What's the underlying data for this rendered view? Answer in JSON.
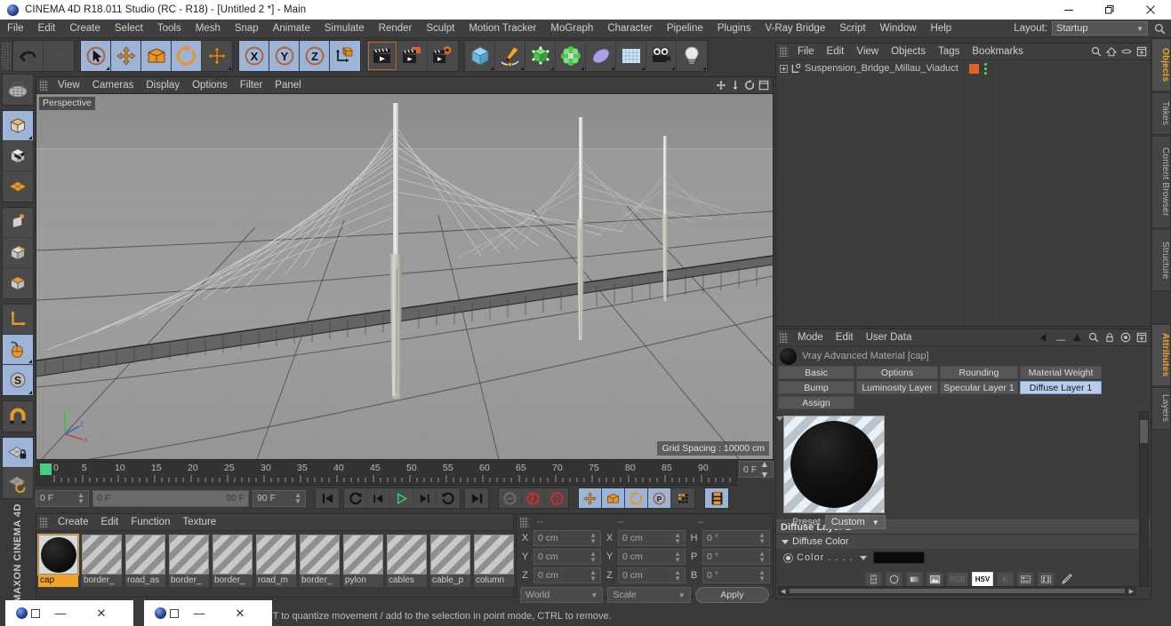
{
  "window": {
    "title": "CINEMA 4D R18.011 Studio (RC - R18) - [Untitled 2 *] - Main",
    "app_icon": "cinema4d-icon",
    "minimize": "minimize-icon",
    "maximize": "restore-icon",
    "close": "close-icon"
  },
  "menubar": {
    "items": [
      "File",
      "Edit",
      "Create",
      "Select",
      "Tools",
      "Mesh",
      "Snap",
      "Animate",
      "Simulate",
      "Render",
      "Sculpt",
      "Motion Tracker",
      "MoGraph",
      "Character",
      "Pipeline",
      "Plugins",
      "V-Ray Bridge",
      "Script",
      "Window",
      "Help"
    ],
    "layout_label": "Layout:",
    "layout_value": "Startup",
    "search_icon": "search-icon"
  },
  "toolbar": {
    "groups": [
      {
        "name": "history",
        "buttons": [
          {
            "name": "undo-button",
            "icon": "undo-arrow-icon",
            "state": "enabled"
          },
          {
            "name": "redo-button",
            "icon": "redo-arrow-icon",
            "state": "disabled"
          }
        ]
      },
      {
        "name": "tools",
        "buttons": [
          {
            "name": "live-selection-tool",
            "icon": "cursor-arrow-icon",
            "state": "active"
          },
          {
            "name": "move-tool",
            "icon": "move-cross-icon",
            "state": "active"
          },
          {
            "name": "scale-tool",
            "icon": "scale-box-icon",
            "state": "active"
          },
          {
            "name": "rotate-tool",
            "icon": "rotate-circle-icon",
            "state": "active"
          },
          {
            "name": "dynamic-place-tool",
            "icon": "move-cross-icon",
            "state": "enabled"
          }
        ]
      },
      {
        "name": "axis-locks",
        "buttons": [
          {
            "name": "lock-x-axis",
            "icon": "x-axis-icon",
            "state": "active"
          },
          {
            "name": "lock-y-axis",
            "icon": "y-axis-icon",
            "state": "active"
          },
          {
            "name": "lock-z-axis",
            "icon": "z-axis-icon",
            "state": "active"
          },
          {
            "name": "world-object-coordinates",
            "icon": "world-axis-cube-icon",
            "state": "enabled"
          }
        ]
      },
      {
        "name": "render",
        "buttons": [
          {
            "name": "render-view-button",
            "icon": "clapperboard-icon",
            "state": "enabled"
          },
          {
            "name": "render-to-picture-viewer-button",
            "icon": "clapperboard-picture-icon",
            "state": "enabled"
          },
          {
            "name": "edit-render-settings-button",
            "icon": "clapperboard-gear-icon",
            "state": "enabled"
          }
        ]
      },
      {
        "name": "create",
        "buttons": [
          {
            "name": "add-cube-button",
            "icon": "cube-icon",
            "state": "enabled"
          },
          {
            "name": "add-spline-button",
            "icon": "pen-spline-icon",
            "state": "enabled"
          },
          {
            "name": "add-generator-button",
            "icon": "green-nurbs-icon",
            "state": "enabled"
          },
          {
            "name": "add-deformer-button",
            "icon": "deformer-icon",
            "state": "enabled"
          },
          {
            "name": "add-scene-object-button",
            "icon": "environment-icon",
            "state": "enabled"
          },
          {
            "name": "add-physical-sky-button",
            "icon": "sky-grid-icon",
            "state": "enabled"
          },
          {
            "name": "add-camera-button",
            "icon": "camera-icon",
            "state": "enabled"
          },
          {
            "name": "add-light-button",
            "icon": "lightbulb-icon",
            "state": "enabled"
          }
        ]
      }
    ]
  },
  "leftbar": {
    "groups": [
      [
        {
          "name": "undo-view-button",
          "icon": "globe-wire-icon",
          "state": "enabled"
        }
      ],
      [
        {
          "name": "model-mode-button",
          "icon": "model-cube-icon",
          "state": "active"
        },
        {
          "name": "texture-mode-button",
          "icon": "texture-cube-icon",
          "state": "enabled"
        },
        {
          "name": "workplane-mode-button",
          "icon": "workplane-grid-icon",
          "state": "enabled"
        }
      ],
      [
        {
          "name": "points-mode-button",
          "icon": "points-cube-icon",
          "state": "enabled"
        },
        {
          "name": "edges-mode-button",
          "icon": "edges-cube-icon",
          "state": "enabled"
        },
        {
          "name": "polygons-mode-button",
          "icon": "polygons-cube-icon",
          "state": "enabled"
        }
      ],
      [
        {
          "name": "object-axis-button",
          "icon": "axis-L-icon",
          "state": "enabled"
        },
        {
          "name": "enable-axis-modification-button",
          "icon": "mouse-icon",
          "state": "active"
        },
        {
          "name": "soft-selection-button",
          "icon": "S-circle-icon",
          "state": "active"
        }
      ],
      [
        {
          "name": "enable-snapping-button",
          "icon": "magnet-icon",
          "state": "enabled"
        }
      ],
      [
        {
          "name": "lock-workplane-button",
          "icon": "locked-grid-icon",
          "state": "active"
        },
        {
          "name": "workplane-rotate-button",
          "icon": "rotate-grid-icon",
          "state": "enabled"
        }
      ]
    ],
    "brand_line1": "MAXON",
    "brand_line2": "CINEMA 4D"
  },
  "viewport": {
    "menus": [
      "View",
      "Cameras",
      "Display",
      "Options",
      "Filter",
      "Panel"
    ],
    "grip": "panel-grip-icon",
    "corner_icons": [
      "pan-view-icon",
      "dolly-view-icon",
      "rotate-view-icon",
      "maximize-view-icon"
    ],
    "camera_label": "Perspective",
    "grid_spacing": "Grid Spacing : 10000 cm",
    "axis_gizmo": {
      "y": "Y",
      "x": "X",
      "z": "Z"
    }
  },
  "timeline": {
    "ruler_labels": [
      "0",
      "5",
      "10",
      "15",
      "20",
      "25",
      "30",
      "35",
      "40",
      "45",
      "50",
      "55",
      "60",
      "65",
      "70",
      "75",
      "80",
      "85",
      "90"
    ],
    "current_frame_right": "0 F",
    "start_frame": "0 F",
    "slider_min": "0 F",
    "slider_max": "90 F",
    "end_frame": "90 F",
    "playback_buttons": [
      {
        "name": "go-to-start-button",
        "icon": "skip-start-icon"
      },
      {
        "name": "go-to-previous-key-button",
        "icon": "prev-key-icon"
      },
      {
        "name": "step-back-button",
        "icon": "step-back-icon"
      },
      {
        "name": "play-button",
        "icon": "play-icon"
      },
      {
        "name": "step-forward-button",
        "icon": "step-forward-icon"
      },
      {
        "name": "go-to-next-key-button",
        "icon": "next-key-icon"
      },
      {
        "name": "go-to-end-button",
        "icon": "skip-end-icon"
      }
    ],
    "record_buttons": [
      {
        "name": "autokeying-button",
        "icon": "autokey-icon",
        "state": "disabled"
      },
      {
        "name": "record-active-objects-button",
        "icon": "record-red-icon",
        "state": "enabled"
      },
      {
        "name": "keyframe-selection-button",
        "icon": "question-red-icon",
        "state": "enabled"
      }
    ],
    "keyflag_buttons": [
      {
        "name": "position-key-button",
        "icon": "move-cross-icon",
        "state": "active"
      },
      {
        "name": "scale-key-button",
        "icon": "scale-box-icon",
        "state": "active"
      },
      {
        "name": "rotation-key-button",
        "icon": "rotate-circle-icon",
        "state": "active"
      },
      {
        "name": "parameter-key-button",
        "icon": "P-circle-icon",
        "state": "active"
      },
      {
        "name": "point-level-animation-button",
        "icon": "pla-dots-icon",
        "state": "enabled"
      }
    ],
    "extra_button": {
      "name": "animation-layers-button",
      "icon": "layers-strip-icon",
      "state": "active"
    }
  },
  "material_manager": {
    "menus": [
      "Create",
      "Edit",
      "Function",
      "Texture"
    ],
    "grip": "panel-grip-icon",
    "materials": [
      {
        "name": "cap",
        "selected": true,
        "preview": "black-sphere"
      },
      {
        "name": "border_",
        "selected": false,
        "preview": "none"
      },
      {
        "name": "road_as",
        "selected": false,
        "preview": "none"
      },
      {
        "name": "border_",
        "selected": false,
        "preview": "none"
      },
      {
        "name": "border_",
        "selected": false,
        "preview": "none"
      },
      {
        "name": "road_m",
        "selected": false,
        "preview": "none"
      },
      {
        "name": "border_",
        "selected": false,
        "preview": "none"
      },
      {
        "name": "pylon",
        "selected": false,
        "preview": "none"
      },
      {
        "name": "cables",
        "selected": false,
        "preview": "none"
      },
      {
        "name": "cable_p",
        "selected": false,
        "preview": "none"
      },
      {
        "name": "column",
        "selected": false,
        "preview": "none"
      }
    ]
  },
  "coordinates": {
    "grip": "panel-grip-icon",
    "headers": [
      "--",
      "--",
      "--"
    ],
    "rows": [
      {
        "pos_label": "X",
        "pos_value": "0 cm",
        "size_label": "X",
        "size_value": "0 cm",
        "rot_label": "H",
        "rot_value": "0 °"
      },
      {
        "pos_label": "Y",
        "pos_value": "0 cm",
        "size_label": "Y",
        "size_value": "0 cm",
        "rot_label": "P",
        "rot_value": "0 °"
      },
      {
        "pos_label": "Z",
        "pos_value": "0 cm",
        "size_label": "Z",
        "size_value": "0 cm",
        "rot_label": "B",
        "rot_value": "0 °"
      }
    ],
    "system_value": "World",
    "mode_value": "Scale",
    "apply_label": "Apply"
  },
  "object_manager": {
    "menus": [
      "File",
      "Edit",
      "View",
      "Objects",
      "Tags",
      "Bookmarks"
    ],
    "grip": "panel-grip-icon",
    "header_icons": [
      "search-icon",
      "home-icon",
      "link-icon",
      "fit-icon"
    ],
    "objects": [
      {
        "name": "Suspension_Bridge_Millau_Viaduct",
        "expander": "expand-plus-icon",
        "type_icon": "null-object-icon",
        "tag_color": "#e2622a",
        "visibility_dots": "green-dots-icon"
      }
    ]
  },
  "attribute_manager": {
    "menus": [
      "Mode",
      "Edit",
      "User Data"
    ],
    "grip": "panel-grip-icon",
    "header_icons": [
      "back-arrow-icon",
      "forward-dash-icon",
      "up-arrow-icon",
      "search-icon",
      "lock-icon",
      "target-icon",
      "fit-icon"
    ],
    "object_title": "Vray Advanced Material [cap]",
    "object_thumb": "black-sphere-icon",
    "tabs": [
      [
        {
          "label": "Basic",
          "active": false
        },
        {
          "label": "Options",
          "active": false
        },
        {
          "label": "Rounding",
          "active": false
        },
        {
          "label": "Material Weight",
          "active": false
        }
      ],
      [
        {
          "label": "Bump",
          "active": false
        },
        {
          "label": "Luminosity Layer",
          "active": false
        },
        {
          "label": "Specular Layer 1",
          "active": false
        },
        {
          "label": "Diffuse Layer 1",
          "active": true
        }
      ],
      [
        {
          "label": "Assign",
          "active": false
        }
      ]
    ],
    "preview": {
      "name": "material-preview",
      "swatch": "black-sphere"
    },
    "preset_label": "Preset",
    "preset_value": "Custom",
    "section_title": "Diffuse Layer 1",
    "subsection_title": "Diffuse Color",
    "color_label": "Color . . . .",
    "color_value": "#0b0b0b",
    "color_tools": [
      {
        "name": "color-spectrum-button",
        "glyph": "⇕",
        "active": false,
        "dim": false
      },
      {
        "name": "color-wheel-button",
        "glyph": "✳",
        "active": false,
        "dim": false
      },
      {
        "name": "color-gradient-button",
        "glyph": "▭",
        "active": false,
        "dim": false
      },
      {
        "name": "color-image-button",
        "glyph": "▲",
        "active": false,
        "dim": false
      },
      {
        "name": "rgb-mode-button",
        "glyph": "RGB",
        "active": false,
        "dim": true
      },
      {
        "name": "hsv-mode-button",
        "glyph": "HSV",
        "active": true,
        "dim": false
      },
      {
        "name": "kelvin-mode-button",
        "glyph": "K",
        "active": false,
        "dim": true
      },
      {
        "name": "color-mixer-button",
        "glyph": "▤",
        "active": false,
        "dim": false
      },
      {
        "name": "color-swatches-button",
        "glyph": "▦",
        "active": false,
        "dim": false
      },
      {
        "name": "color-picker-button",
        "glyph": "✎",
        "active": false,
        "dim": false
      }
    ]
  },
  "right_tabs": {
    "upper": [
      {
        "label": "Objects",
        "active": true
      },
      {
        "label": "Takes",
        "active": false
      },
      {
        "label": "Content Browser",
        "active": false
      },
      {
        "label": "Structure",
        "active": false
      }
    ],
    "lower": [
      {
        "label": "Attributes",
        "active": true
      },
      {
        "label": "Layers",
        "active": false
      }
    ]
  },
  "statusbar": {
    "message": "FT to quantize movement / add to the selection in point mode, CTRL to remove.",
    "overlay_windows": [
      {
        "name": "window-strip-1",
        "minimize": "—",
        "maximize": "▢",
        "close": "✕"
      },
      {
        "name": "window-strip-2",
        "minimize": "—",
        "maximize": "▢",
        "close": "✕"
      }
    ]
  }
}
